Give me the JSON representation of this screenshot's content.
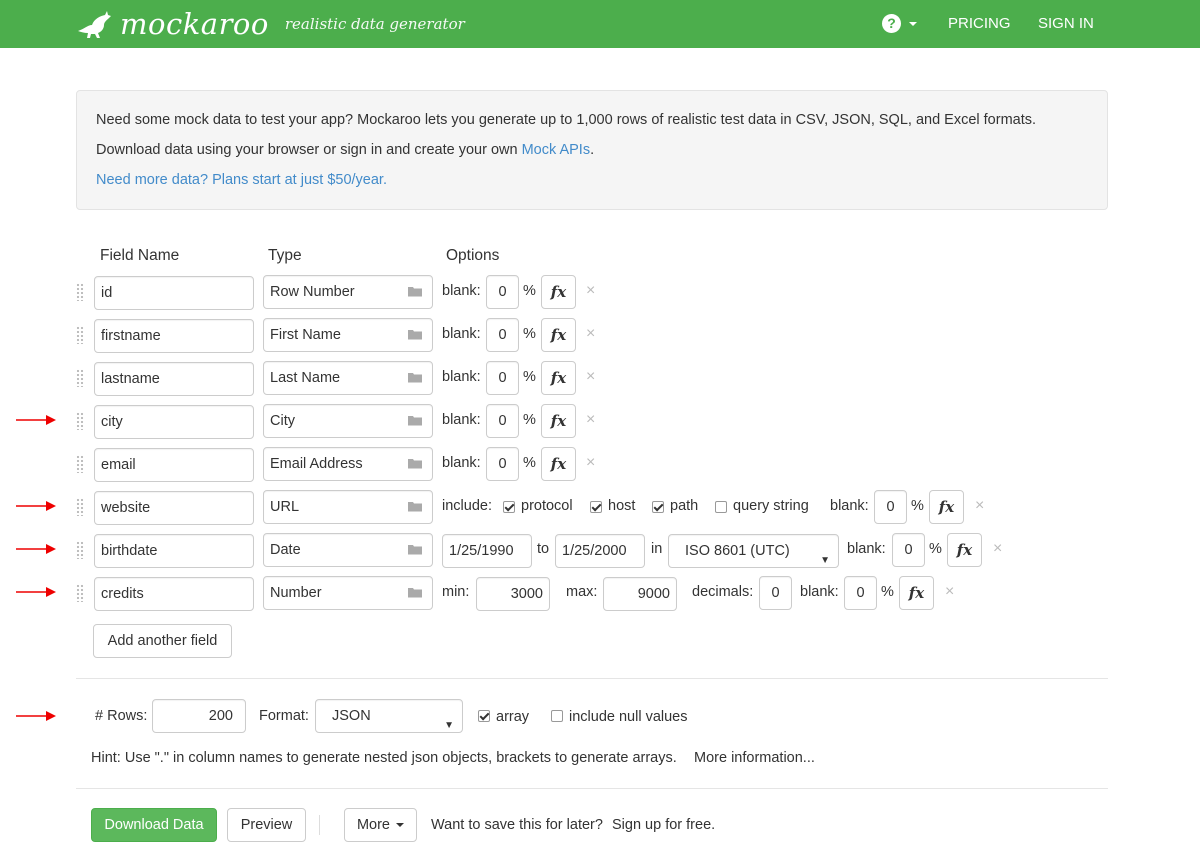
{
  "navbar": {
    "brand": "mockaroo",
    "tagline": "realistic data generator",
    "help_icon": "?",
    "pricing": "PRICING",
    "sign_in": "SIGN IN",
    "color": "#4cae4c"
  },
  "intro": {
    "line1": "Need some mock data to test your app? Mockaroo lets you generate up to 1,000 rows of realistic test data in CSV, JSON, SQL, and Excel formats.",
    "line2_prefix": "Download data using your browser or sign in and create your own ",
    "line2_link": "Mock APIs",
    "line2_suffix": ".",
    "line3_link": "Need more data? Plans start at just $50/year."
  },
  "columns": {
    "field_name": "Field Name",
    "type": "Type",
    "options": "Options"
  },
  "common": {
    "blank_label": "blank:",
    "blank_value": "0",
    "percent": "%",
    "fx": "fx",
    "remove": "×"
  },
  "fields": [
    {
      "name": "id",
      "type": "Row Number"
    },
    {
      "name": "firstname",
      "type": "First Name"
    },
    {
      "name": "lastname",
      "type": "Last Name"
    },
    {
      "name": "city",
      "type": "City"
    },
    {
      "name": "email",
      "type": "Email Address"
    },
    {
      "name": "website",
      "type": "URL"
    },
    {
      "name": "birthdate",
      "type": "Date"
    },
    {
      "name": "credits",
      "type": "Number"
    }
  ],
  "url_options": {
    "include_label": "include:",
    "protocol": "protocol",
    "host": "host",
    "path": "path",
    "query_string": "query string",
    "protocol_checked": true,
    "host_checked": true,
    "path_checked": true,
    "query_string_checked": false
  },
  "date_options": {
    "from": "1/25/1990",
    "to_label": "to",
    "to": "1/25/2000",
    "in_label": "in",
    "format": "ISO 8601 (UTC)"
  },
  "number_options": {
    "min_label": "min:",
    "min": "3000",
    "max_label": "max:",
    "max": "9000",
    "decimals_label": "decimals:",
    "decimals": "0"
  },
  "add_field_button": "Add another field",
  "output": {
    "rows_label": "# Rows:",
    "rows": "200",
    "format_label": "Format:",
    "format": "JSON",
    "array_label": "array",
    "array_checked": true,
    "include_null_label": "include null values",
    "include_null_checked": false,
    "hint": "Hint: Use \".\" in column names to generate nested json objects, brackets to generate arrays.",
    "more_info_link": "More information..."
  },
  "actions": {
    "download": "Download Data",
    "preview": "Preview",
    "more": "More",
    "save_prompt": "Want to save this for later?",
    "signup_link": "Sign up for free."
  }
}
